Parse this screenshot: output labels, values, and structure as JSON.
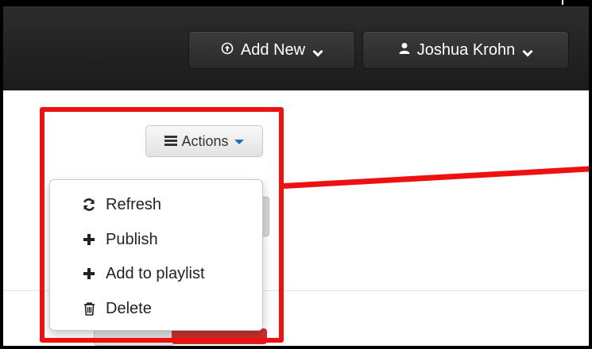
{
  "header": {
    "add_new_label": "Add New",
    "add_new_icon": "circle-upload-icon",
    "user_label": "Joshua Krohn",
    "user_icon": "user-icon"
  },
  "toolbar": {
    "actions_label": "Actions"
  },
  "actions_menu": {
    "items": [
      {
        "label": "Refresh",
        "icon": "refresh-icon"
      },
      {
        "label": "Publish",
        "icon": "plus-icon"
      },
      {
        "label": "Add to playlist",
        "icon": "plus-icon"
      },
      {
        "label": "Delete",
        "icon": "trash-icon"
      }
    ]
  },
  "colors": {
    "highlight": "#ee1111",
    "header_bg": "#222222",
    "caret": "#1e6fb5",
    "delete_button": "#c9302c"
  }
}
